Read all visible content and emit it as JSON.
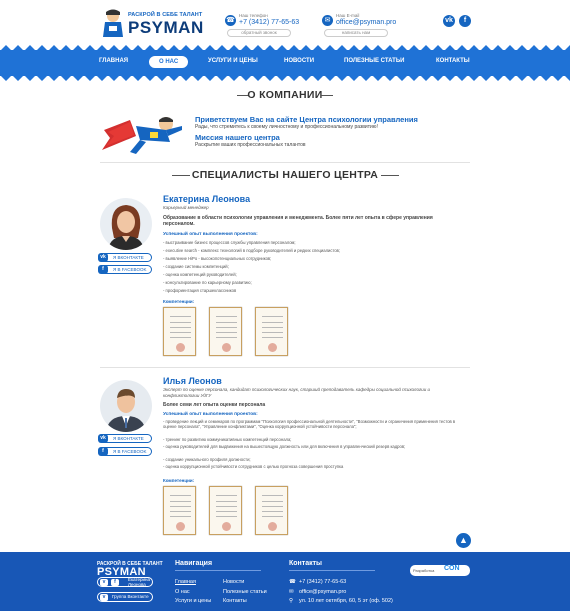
{
  "header": {
    "logo_tagline": "РАСКРОЙ В СЕБЕ ТАЛАНТ",
    "logo_name": "PSYMAN",
    "phone_label": "Наш телефон",
    "phone": "+7 (3412) 77-65-63",
    "callback_label": "обратный звонок",
    "email_label": "Наш E-mail",
    "email": "office@psyman.pro",
    "write_label": "написать нам",
    "vk": "vk",
    "fb": "f"
  },
  "nav": {
    "items": [
      {
        "label": "ГЛАВНАЯ"
      },
      {
        "label": "О НАС"
      },
      {
        "label": "УСЛУГИ И ЦЕНЫ"
      },
      {
        "label": "НОВОСТИ"
      },
      {
        "label": "ПОЛЕЗНЫЕ СТАТЬИ"
      },
      {
        "label": "КОНТАКТЫ"
      }
    ],
    "active_index": 1
  },
  "about": {
    "title": "О КОМПАНИИ",
    "welcome_heading": "Приветствуем Вас на сайте Центра психологии управления",
    "welcome_text": "Рады, что стремитесь к своему личностному и профессиональному развитию!",
    "mission_heading": "Миссия нашего центра",
    "mission_text": "Раскрытие ваших профессиональных талантов"
  },
  "specialists": {
    "title": "СПЕЦИАЛИСТЫ НАШЕГО ЦЕНТРА",
    "list": [
      {
        "name": "Екатерина Леонова",
        "role": "Карьерный менеджер",
        "desc": "Образование в области психологии управления и менеджмента. Более пяти лет опыта в сфере управления персоналом.",
        "experience_heading": "Успешный опыт выполнения проектов:",
        "bullets": [
          "- выстраивание бизнес процессов службы управления персоналом;",
          "- executive search - комплекс технологий в подборе руководителей и редких специалистов;",
          "- выявление HiPo - высокопотенциальных сотрудников;",
          "- создание системы компетенций;",
          "- оценка компетенций руководителей;",
          "- консультирование по карьерному развитию;",
          "- профориентация старшеклассников"
        ],
        "vk_label": "Я ВКОНТАКТЕ",
        "fb_label": "Я В FACEBOOK",
        "cert_label": "Компетенции:"
      },
      {
        "name": "Илья Леонов",
        "role": "Эксперт по оценке персонала, кандидат психологических наук, старший преподаватель кафедры социальной психологии и конфликтологии УдГУ",
        "desc": "Более семи лет опыта оценки персонала",
        "experience_heading": "Успешный опыт выполнения проектов:",
        "bullets": [
          "- проведение лекций и семинаров по программам \"Психология профессиональной деятельности\", \"Возможности и ограничения применения тестов в оценке персонала\", \"Управление конфликтами\", \"Оценка коррупционной устойчивости персонала\";",
          "- тренинг по развитию коммуникативных компетенций персонала;",
          "- оценка руководителей для выдвижения на вышестоящую должность или для включения в управленческий резерв кадров;",
          "- создание уникального профиля должности;",
          "- оценка коррупционной устойчивости сотрудников с целью прогноза совершения проступка"
        ],
        "vk_label": "Я ВКОНТАКТЕ",
        "fb_label": "Я В FACEBOOK",
        "cert_label": "Компетенции:"
      }
    ]
  },
  "footer": {
    "tagline": "РАСКРОЙ В СЕБЕ ТАЛАНТ",
    "name": "PSYMAN",
    "person_btn_1": "Екатерина",
    "person_btn_2": "Леонова",
    "group_btn": "Группа Вконтакте",
    "nav_heading": "Навигация",
    "nav_links": [
      "Главная",
      "О нас",
      "Услуги и цены",
      "Новости",
      "Полезные статьи",
      "Контакты"
    ],
    "contacts_heading": "Контакты",
    "phone": "+7 (3412) 77-65-63",
    "email": "office@psyman.pro",
    "address": "ул. 10 лет октября, 60, 5 эт (оф. 502)",
    "dev_label": "Разработка",
    "dev_mark": "CON"
  },
  "colors": {
    "brand": "#1565c0",
    "nav": "#1f72d6",
    "footer": "#1857b6"
  }
}
